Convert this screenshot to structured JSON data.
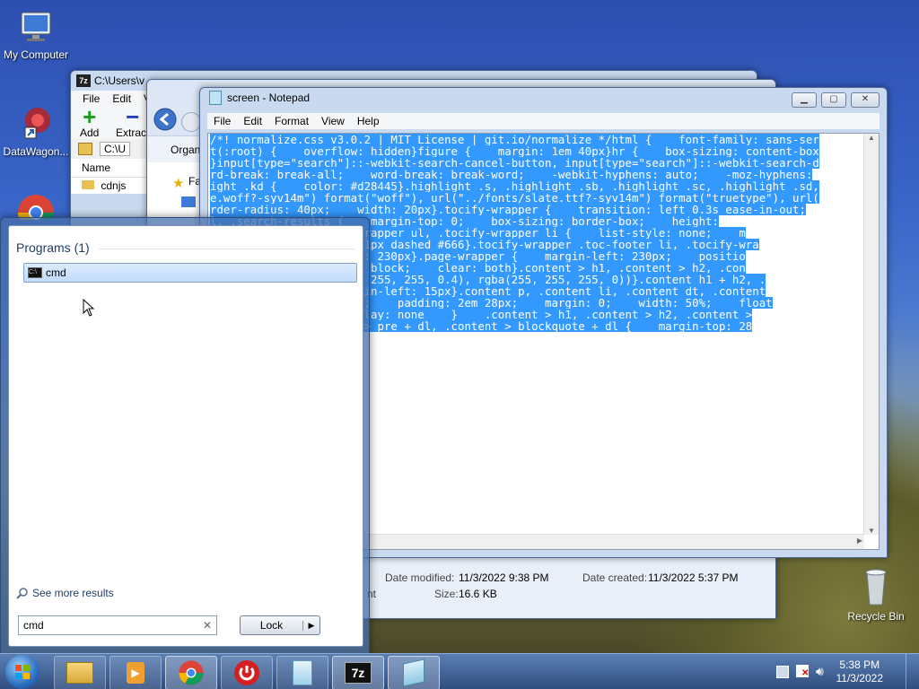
{
  "desktop": {
    "icons": [
      {
        "label": "My Computer"
      },
      {
        "label": "DataWagon..."
      },
      {
        "label": "Recycle Bin"
      }
    ]
  },
  "sevenzip": {
    "title": "C:\\Users\\v",
    "menu": [
      "File",
      "Edit",
      "V"
    ],
    "toolbar": {
      "add": "Add",
      "extract": "Extract"
    },
    "path": "C:\\U",
    "column_name": "Name",
    "row": "cdnjs"
  },
  "explorer": {
    "organize": "Organ",
    "fav": "Fa",
    "details": {
      "date_modified_label": "Date modified:",
      "date_modified": "11/3/2022 9:38 PM",
      "date_created_label": "Date created:",
      "date_created": "11/3/2022 5:37 PM",
      "size_label": "Size:",
      "size": "16.6 KB",
      "partial": "nt"
    }
  },
  "notepad": {
    "title": "screen - Notepad",
    "menu": [
      "File",
      "Edit",
      "Format",
      "View",
      "Help"
    ],
    "lines": [
      "/*! normalize.css v3.0.2 | MIT License | git.io/normalize */html {    font-family: sans-ser",
      "t(:root) {    overflow: hidden}figure {    margin: 1em 40px}hr {    box-sizing: content-box",
      "}input[type=\"search\"]::-webkit-search-cancel-button, input[type=\"search\"]::-webkit-search-d",
      "rd-break: break-all;    word-break: break-word;    -webkit-hyphens: auto;    -moz-hyphens:",
      "ight .kd {    color: #d28445}.highlight .s, .highlight .sb, .highlight .sc, .highlight .sd,",
      "e.woff?-syv14m\") format(\"woff\"), url(\"../fonts/slate.ttf?-syv14m\") format(\"truetype\"), url(",
      "rder-radius: 40px;    width: 20px}.tocify-wrapper {    transition: left 0.3s ease-in-out;",
      "l, .search-results {    margin-top: 0;    box-sizing: border-box;    height:",
      ".tocify-focus}.tocify-wrapper ul, .tocify-wrapper li {    list-style: none;    m",
      "ul ul {    border-top: 1px dashed #666}.tocify-wrapper .toc-footer li, .tocify-wra",
      "-wrapper.open {    left: 230px}.page-wrapper {    margin-left: 230px;    positio",
      "a.content {    display: block;    clear: both}.content > h1, .content > h2, .con",
      "gradient(top, rgba(255, 255, 255, 0.4), rgba(255, 255, 255, 0))}.content h1 + h2, .",
      "#ccc}.content {    margin-left: 15px}.content p, .content li, .content dt, .content",
      "#4E5256;    color: #fff;    padding: 2em 28px;    margin: 0;    width: 50%;    float",
      "wrapper .lang {    display: none    }    .content > h1, .content > h2, .content >",
      "e > pre + dl, .content > pre + dl, .content > blockquote + dl {    margin-top: 28"
    ]
  },
  "start_menu": {
    "programs_header": "Programs (1)",
    "program": "cmd",
    "see_more": "See more results",
    "search_value": "cmd",
    "lock_label": "Lock"
  },
  "taskbar": {
    "time": "5:38 PM",
    "date": "11/3/2022"
  }
}
